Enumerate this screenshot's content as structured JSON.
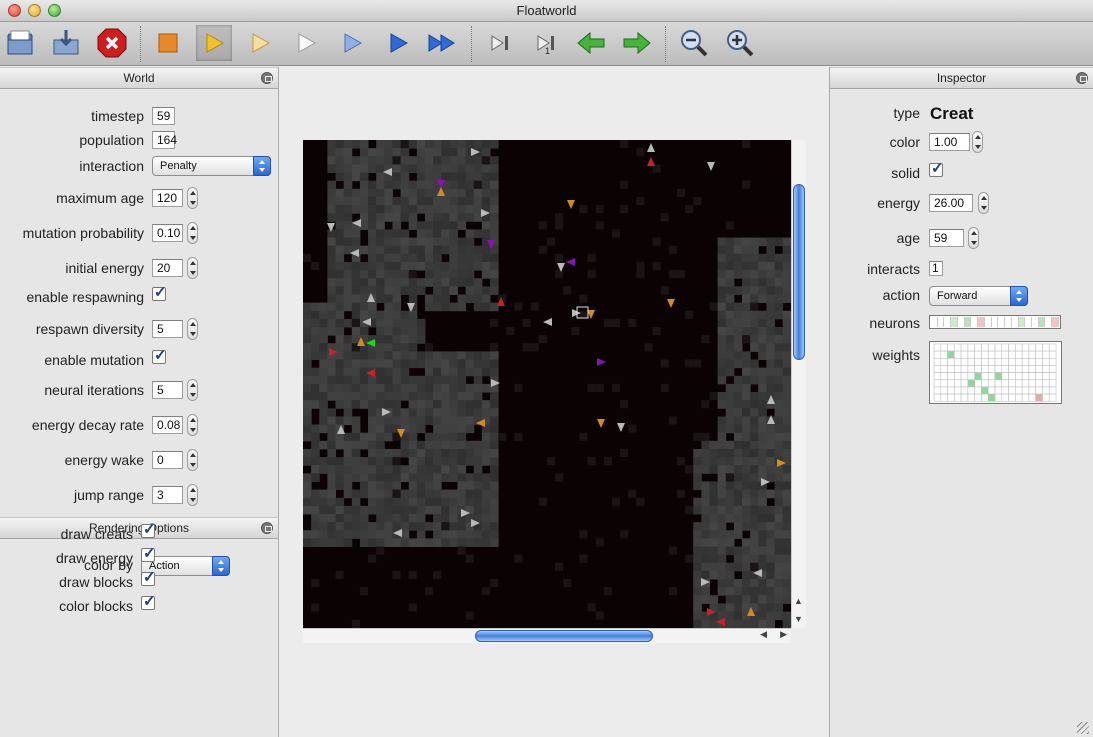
{
  "window": {
    "title": "Floatworld"
  },
  "toolbar": {
    "buttons": [
      "open-icon",
      "save-icon",
      "stop-red-icon",
      "stop-icon",
      "play-icon",
      "play-slow-icon",
      "play-slower-icon",
      "play-normal-icon",
      "play-fast-icon",
      "fast-forward-icon",
      "step-icon",
      "step-one-icon",
      "back-arrow-icon",
      "forward-arrow-icon",
      "zoom-out-icon",
      "zoom-in-icon"
    ]
  },
  "world": {
    "title": "World",
    "fields": [
      {
        "label": "timestep",
        "value": "59",
        "kind": "text"
      },
      {
        "label": "population",
        "value": "164",
        "kind": "text"
      },
      {
        "label": "interaction",
        "value": "Penalty",
        "kind": "select"
      },
      {
        "label": "maximum age",
        "value": "120",
        "kind": "stepper"
      },
      {
        "label": "mutation probability",
        "value": "0.10",
        "kind": "stepper"
      },
      {
        "label": "initial energy",
        "value": "20",
        "kind": "stepper"
      },
      {
        "label": "enable respawning",
        "value": "checked",
        "kind": "check"
      },
      {
        "label": "respawn diversity",
        "value": "5",
        "kind": "stepper"
      },
      {
        "label": "enable mutation",
        "value": "checked",
        "kind": "check"
      },
      {
        "label": "neural iterations",
        "value": "5",
        "kind": "stepper"
      },
      {
        "label": "energy decay rate",
        "value": "0.08",
        "kind": "stepper"
      },
      {
        "label": "energy wake",
        "value": "0",
        "kind": "stepper"
      },
      {
        "label": "jump range",
        "value": "3",
        "kind": "stepper"
      }
    ]
  },
  "rendering": {
    "title": "Rendering Options",
    "color_by_label": "color by",
    "color_by_value": "Action",
    "checks": [
      {
        "label": "draw creats",
        "checked": true
      },
      {
        "label": "draw energy",
        "checked": true
      },
      {
        "label": "draw blocks",
        "checked": true
      },
      {
        "label": "color blocks",
        "checked": true
      }
    ]
  },
  "inspector": {
    "title": "Inspector",
    "type_label": "type",
    "type_value": "Creat",
    "color_label": "color",
    "color_value": "1.00",
    "solid_label": "solid",
    "energy_label": "energy",
    "energy_value": "26.00",
    "age_label": "age",
    "age_value": "59",
    "interacts_label": "interacts",
    "interacts_value": "1",
    "action_label": "action",
    "action_value": "Forward",
    "neurons_label": "neurons",
    "weights_label": "weights"
  },
  "colors": {
    "creat_gray": "#b9b9b9",
    "creat_orange": "#d58a1e",
    "creat_red": "#c7222a",
    "creat_purple": "#8a11b5",
    "creat_green": "#1ed614",
    "block_gray": "#3c3c3c",
    "accent_blue": "#2f6bd6"
  }
}
